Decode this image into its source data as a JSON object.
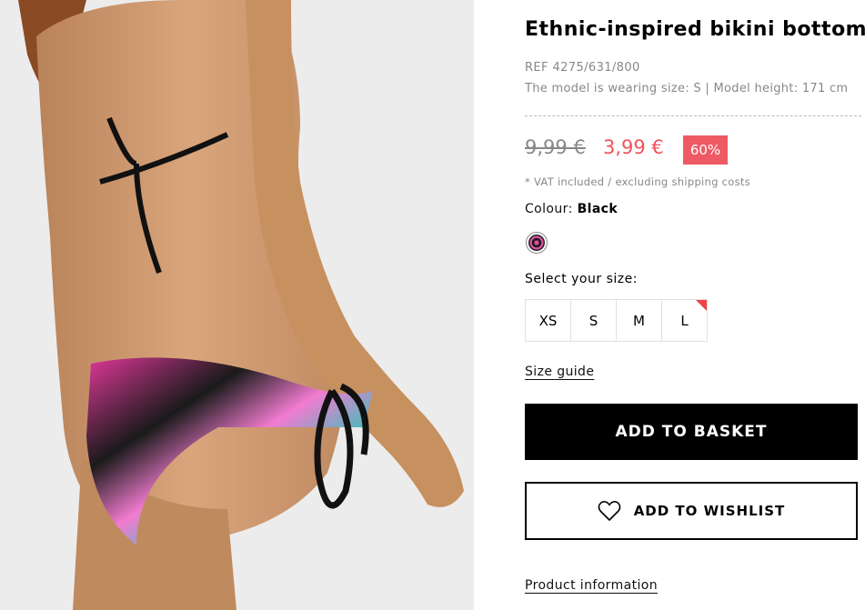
{
  "product": {
    "title": "Ethnic-inspired bikini bottoms",
    "ref": "REF 4275/631/800",
    "model_info": "The model is wearing size: S | Model height: 171 cm",
    "image_icon": "product-photo"
  },
  "price": {
    "old": "9,99 €",
    "current": "3,99 €",
    "discount": "60%",
    "vat_note": "* VAT included / excluding shipping costs",
    "sale_color": "#f0525a"
  },
  "colour": {
    "label": "Colour:",
    "value": "Black"
  },
  "sizes": {
    "label": "Select your size:",
    "options": [
      "XS",
      "S",
      "M",
      "L"
    ]
  },
  "links": {
    "size_guide": "Size guide",
    "product_information": "Product information"
  },
  "actions": {
    "add_to_basket": "ADD TO BASKET",
    "add_to_wishlist": "ADD TO WISHLIST",
    "wishlist_icon": "heart-icon"
  }
}
